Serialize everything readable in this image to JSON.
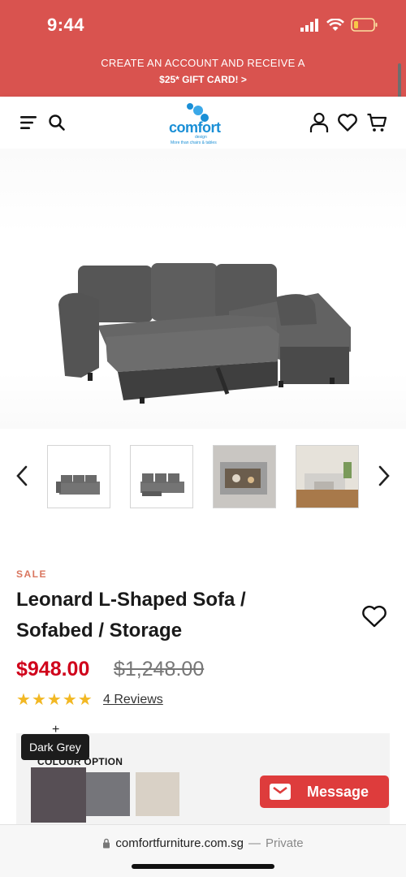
{
  "status_bar": {
    "time": "9:44"
  },
  "promo": {
    "line1": "CREATE AN ACCOUNT AND RECEIVE A",
    "line2": "$25* GIFT CARD! >"
  },
  "header": {
    "logo_word": "comfort",
    "logo_sub": "design",
    "logo_tagline": "More than chairs & tables",
    "icons": [
      "menu-icon",
      "search-icon",
      "account-icon",
      "wishlist-icon",
      "cart-icon"
    ]
  },
  "gallery": {
    "thumbnail_count": 4
  },
  "product": {
    "badge": "SALE",
    "title_line1": "Leonard L-Shaped Sofa /",
    "title_line2": "Sofabed / Storage",
    "price": "$948.00",
    "original_price": "$1,248.00",
    "rating": 5,
    "reviews_text": "4 Reviews"
  },
  "colour_option": {
    "label": "COLOUR OPTION",
    "tooltip": "Dark Grey",
    "swatches": [
      {
        "name": "Dark Grey",
        "color": "#574f55",
        "selected": true
      },
      {
        "color": "#75757a"
      },
      {
        "color": "#d9d1c6"
      }
    ]
  },
  "message_button": {
    "label": "Message"
  },
  "browser": {
    "url": "comfortfurniture.com.sg",
    "separator": "—",
    "mode": "Private"
  },
  "colors": {
    "brand_red": "#d9534f",
    "price_red": "#d0021b",
    "star": "#f2b824",
    "logo_blue": "#1a8fd6"
  }
}
